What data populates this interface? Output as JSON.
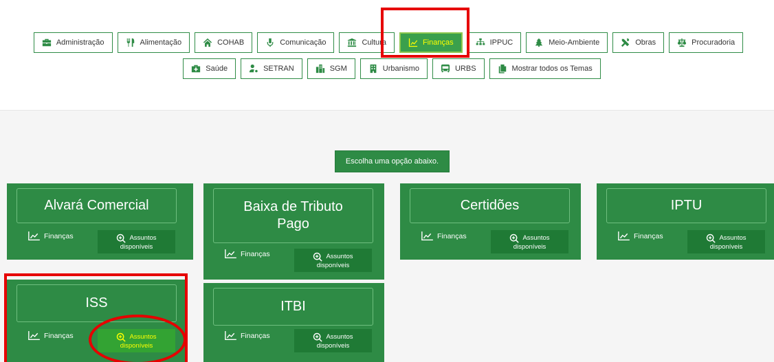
{
  "themes": {
    "row1": [
      {
        "label": "Administração",
        "icon": "briefcase-icon"
      },
      {
        "label": "Alimentação",
        "icon": "utensils-icon"
      },
      {
        "label": "COHAB",
        "icon": "home-icon"
      },
      {
        "label": "Comunicação",
        "icon": "microphone-icon"
      },
      {
        "label": "Cultura",
        "icon": "museum-icon"
      },
      {
        "label": "Finanças",
        "icon": "chart-line-icon",
        "active": true
      },
      {
        "label": "IPPUC",
        "icon": "sitemap-icon"
      },
      {
        "label": "Meio-Ambiente",
        "icon": "tree-icon"
      },
      {
        "label": "Obras",
        "icon": "tools-icon"
      },
      {
        "label": "Procuradoria",
        "icon": "balance-scale-icon"
      }
    ],
    "row2": [
      {
        "label": "Saúde",
        "icon": "medkit-icon"
      },
      {
        "label": "SETRAN",
        "icon": "user-cog-icon"
      },
      {
        "label": "SGM",
        "icon": "city-icon"
      },
      {
        "label": "Urbanismo",
        "icon": "building-icon"
      },
      {
        "label": "URBS",
        "icon": "bus-icon"
      },
      {
        "label": "Mostrar todos os Temas",
        "icon": "copy-icon"
      }
    ]
  },
  "choose_label": "Escolha uma opção abaixo.",
  "cards": [
    {
      "title": "Alvará Comercial",
      "category": "Finanças",
      "btn_line1": "Assuntos",
      "btn_line2": "disponíveis"
    },
    {
      "title": "Baixa de Tributo Pago",
      "category": "Finanças",
      "btn_line1": "Assuntos",
      "btn_line2": "disponíveis"
    },
    {
      "title": "Certidões",
      "category": "Finanças",
      "btn_line1": "Assuntos",
      "btn_line2": "disponíveis"
    },
    {
      "title": "IPTU",
      "category": "Finanças",
      "btn_line1": "Assuntos",
      "btn_line2": "disponíveis"
    },
    {
      "title": "ISS",
      "category": "Finanças",
      "btn_line1": "Assuntos",
      "btn_line2": "disponíveis"
    },
    {
      "title": "ITBI",
      "category": "Finanças",
      "btn_line1": "Assuntos",
      "btn_line2": "disponíveis"
    }
  ],
  "colors": {
    "primary_green": "#2e8b45",
    "button_green": "#1f7a35",
    "active_text": "#ffff00",
    "annotation_red": "#e60000"
  }
}
